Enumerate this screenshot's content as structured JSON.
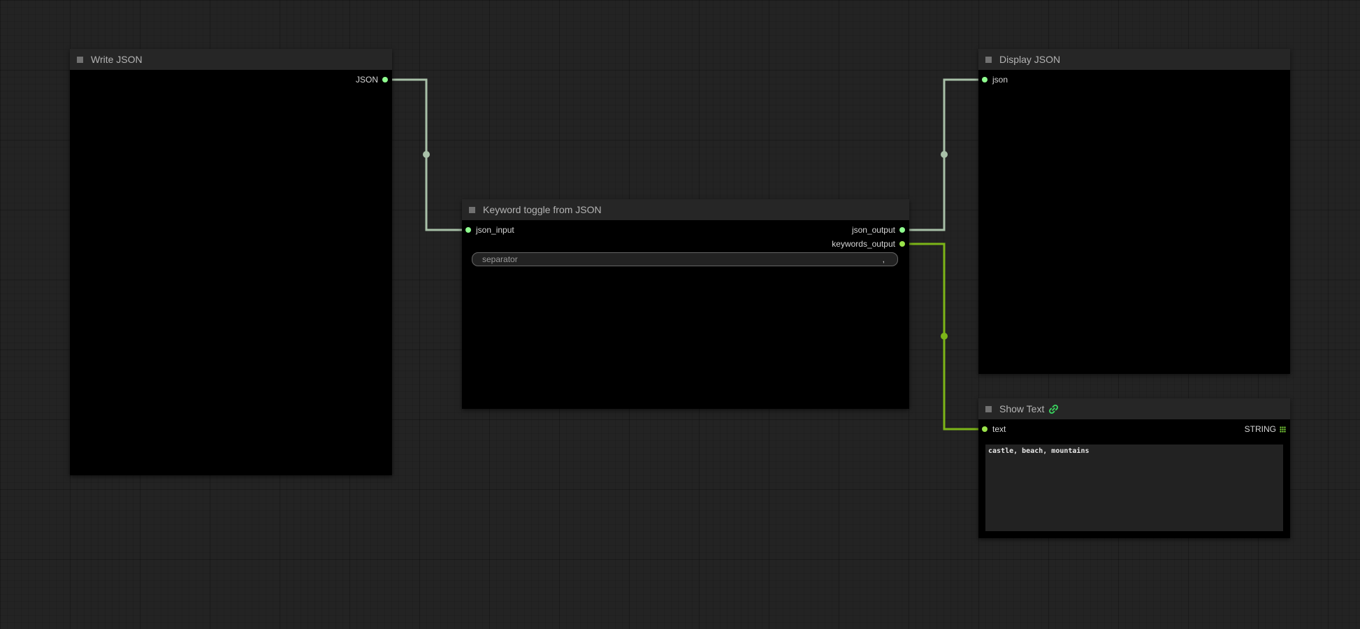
{
  "colors": {
    "canvas_background": "#232323",
    "node_background": "#000000",
    "node_title_background": "#262626",
    "node_title_text": "#b4b4b4",
    "json_link": "#a8c0a8",
    "string_link": "#7cb518",
    "json_slot": "#8fff8f",
    "string_slot": "#9ae34a"
  },
  "nodes": {
    "write_json": {
      "title": "Write JSON",
      "outputs": [
        "JSON"
      ]
    },
    "keyword_toggle": {
      "title": "Keyword toggle from JSON",
      "inputs": [
        "json_input"
      ],
      "outputs": [
        "json_output",
        "keywords_output"
      ],
      "widget": {
        "label": "separator",
        "value": ","
      }
    },
    "display_json": {
      "title": "Display JSON",
      "inputs": [
        "json"
      ]
    },
    "show_text": {
      "title": "Show Text",
      "title_icon": "link-chain-icon",
      "inputs": [
        "text"
      ],
      "outputs": [
        "STRING"
      ],
      "output_icon": "grid-dots-icon",
      "text_value": "castle, beach, mountains"
    }
  },
  "links": [
    {
      "from": "Write JSON.JSON",
      "to": "Keyword toggle from JSON.json_input",
      "type": "JSON"
    },
    {
      "from": "Keyword toggle from JSON.json_output",
      "to": "Display JSON.json",
      "type": "JSON"
    },
    {
      "from": "Keyword toggle from JSON.keywords_output",
      "to": "Show Text.text",
      "type": "STRING"
    }
  ]
}
